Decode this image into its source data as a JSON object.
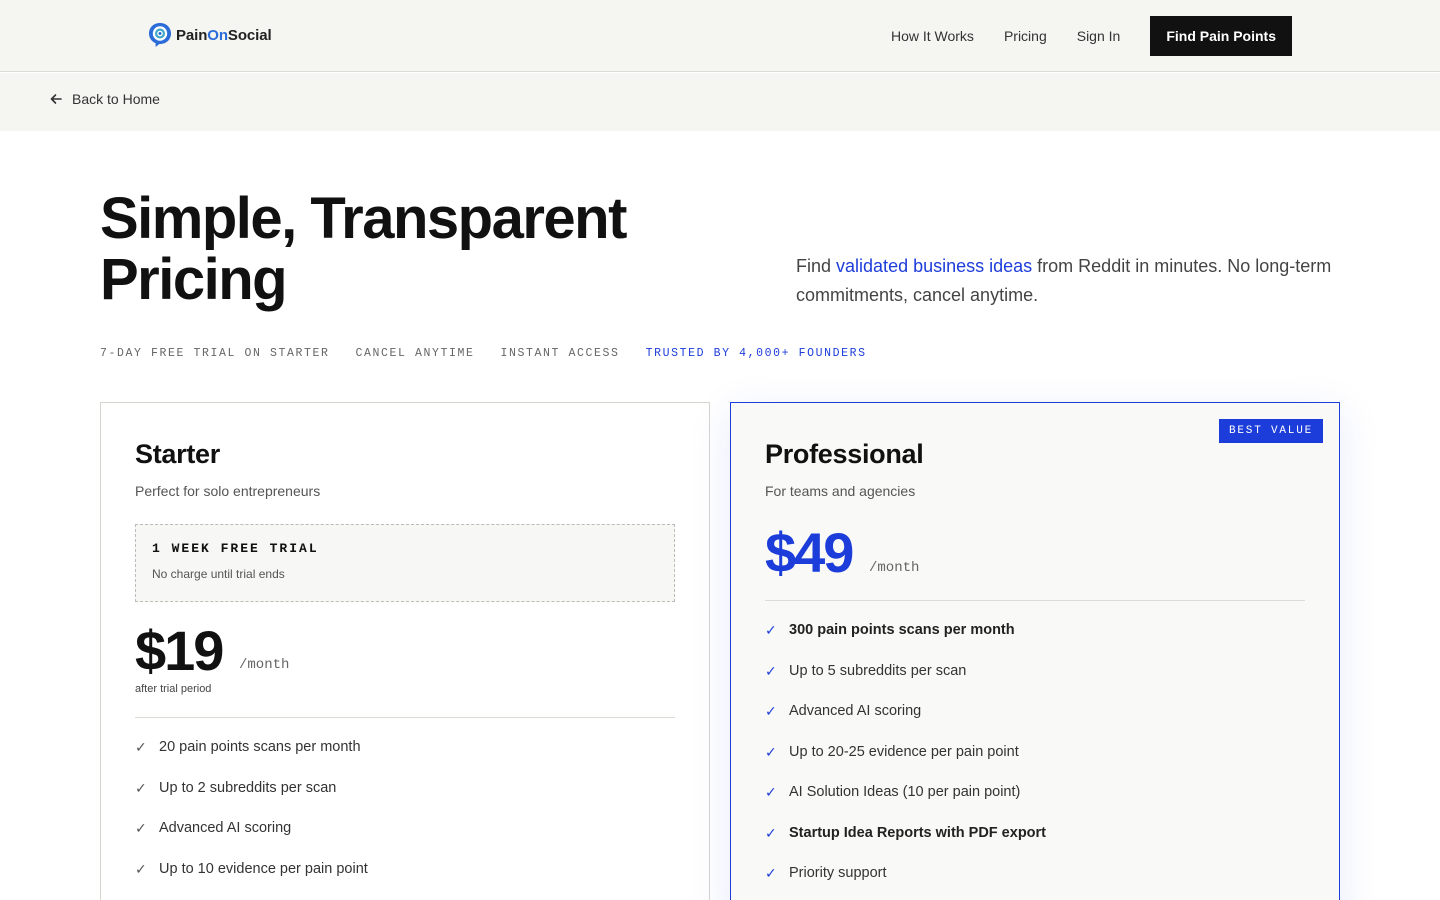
{
  "header": {
    "logo_name_part1": "Pain",
    "logo_name_part2": "On",
    "logo_name_part3": "Social",
    "nav": [
      "How It Works",
      "Pricing",
      "Sign In"
    ],
    "cta": "Find Pain Points"
  },
  "subbar": {
    "back_label": "Back to Home"
  },
  "hero": {
    "title_line1": "Simple, Transparent",
    "title_line2": "Pricing",
    "subtitle_pre": "Find ",
    "subtitle_highlight": "validated business ideas",
    "subtitle_post": " from Reddit in minutes. No long-term commitments, cancel anytime.",
    "badges": [
      "7-DAY FREE TRIAL ON STARTER",
      "CANCEL ANYTIME",
      "INSTANT ACCESS"
    ],
    "badge_highlight": "TRUSTED BY 4,000+ FOUNDERS"
  },
  "plans": {
    "starter": {
      "name": "Starter",
      "description": "Perfect for solo entrepreneurs",
      "trial_title": "1 WEEK FREE TRIAL",
      "trial_note": "No charge until trial ends",
      "price": "$19",
      "per": "/month",
      "after": "after trial period",
      "features": [
        {
          "text": "20 pain points scans per month",
          "bold": false
        },
        {
          "text": "Up to 2 subreddits per scan",
          "bold": false
        },
        {
          "text": "Advanced AI scoring",
          "bold": false
        },
        {
          "text": "Up to 10 evidence per pain point",
          "bold": false
        }
      ]
    },
    "professional": {
      "name": "Professional",
      "description": "For teams and agencies",
      "badge": "BEST VALUE",
      "price": "$49",
      "per": "/month",
      "features": [
        {
          "text": "300 pain points scans per month",
          "bold": true
        },
        {
          "text": "Up to 5 subreddits per scan",
          "bold": false
        },
        {
          "text": "Advanced AI scoring",
          "bold": false
        },
        {
          "text": "Up to 20-25 evidence per pain point",
          "bold": false
        },
        {
          "text": "AI Solution Ideas (10 per pain point)",
          "bold": false
        },
        {
          "text": "Startup Idea Reports with PDF export",
          "bold": true
        },
        {
          "text": "Priority support",
          "bold": false
        }
      ]
    }
  },
  "check_glyph": "✓",
  "colors": {
    "accent": "#1d3ddb",
    "dark": "#111111",
    "background": "#f5f5f2"
  }
}
